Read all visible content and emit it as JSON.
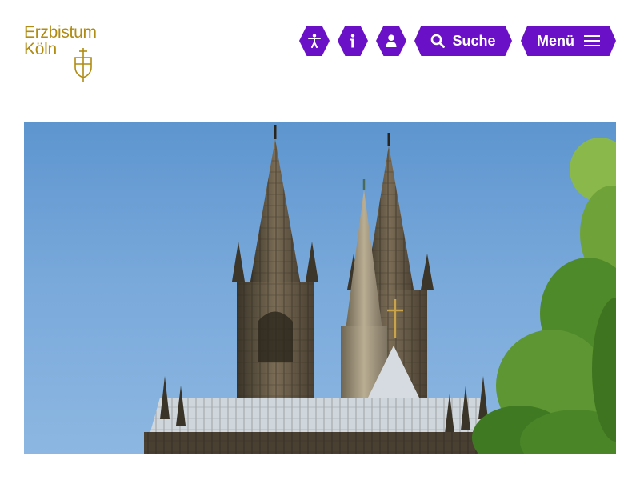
{
  "logo": {
    "line1": "Erzbistum",
    "line2": "Köln",
    "emblem_icon": "cross-emblem-icon",
    "color": "#b08c12"
  },
  "header": {
    "accent_color": "#6a10c6",
    "accessibility_icon": "accessibility-icon",
    "info_icon": "info-icon",
    "user_icon": "user-icon",
    "search": {
      "icon": "search-icon",
      "label": "Suche"
    },
    "menu": {
      "label": "Menü",
      "icon": "hamburger-icon"
    }
  },
  "hero": {
    "subject": "Cologne Cathedral twin spires against a blue sky with green tree foliage"
  }
}
